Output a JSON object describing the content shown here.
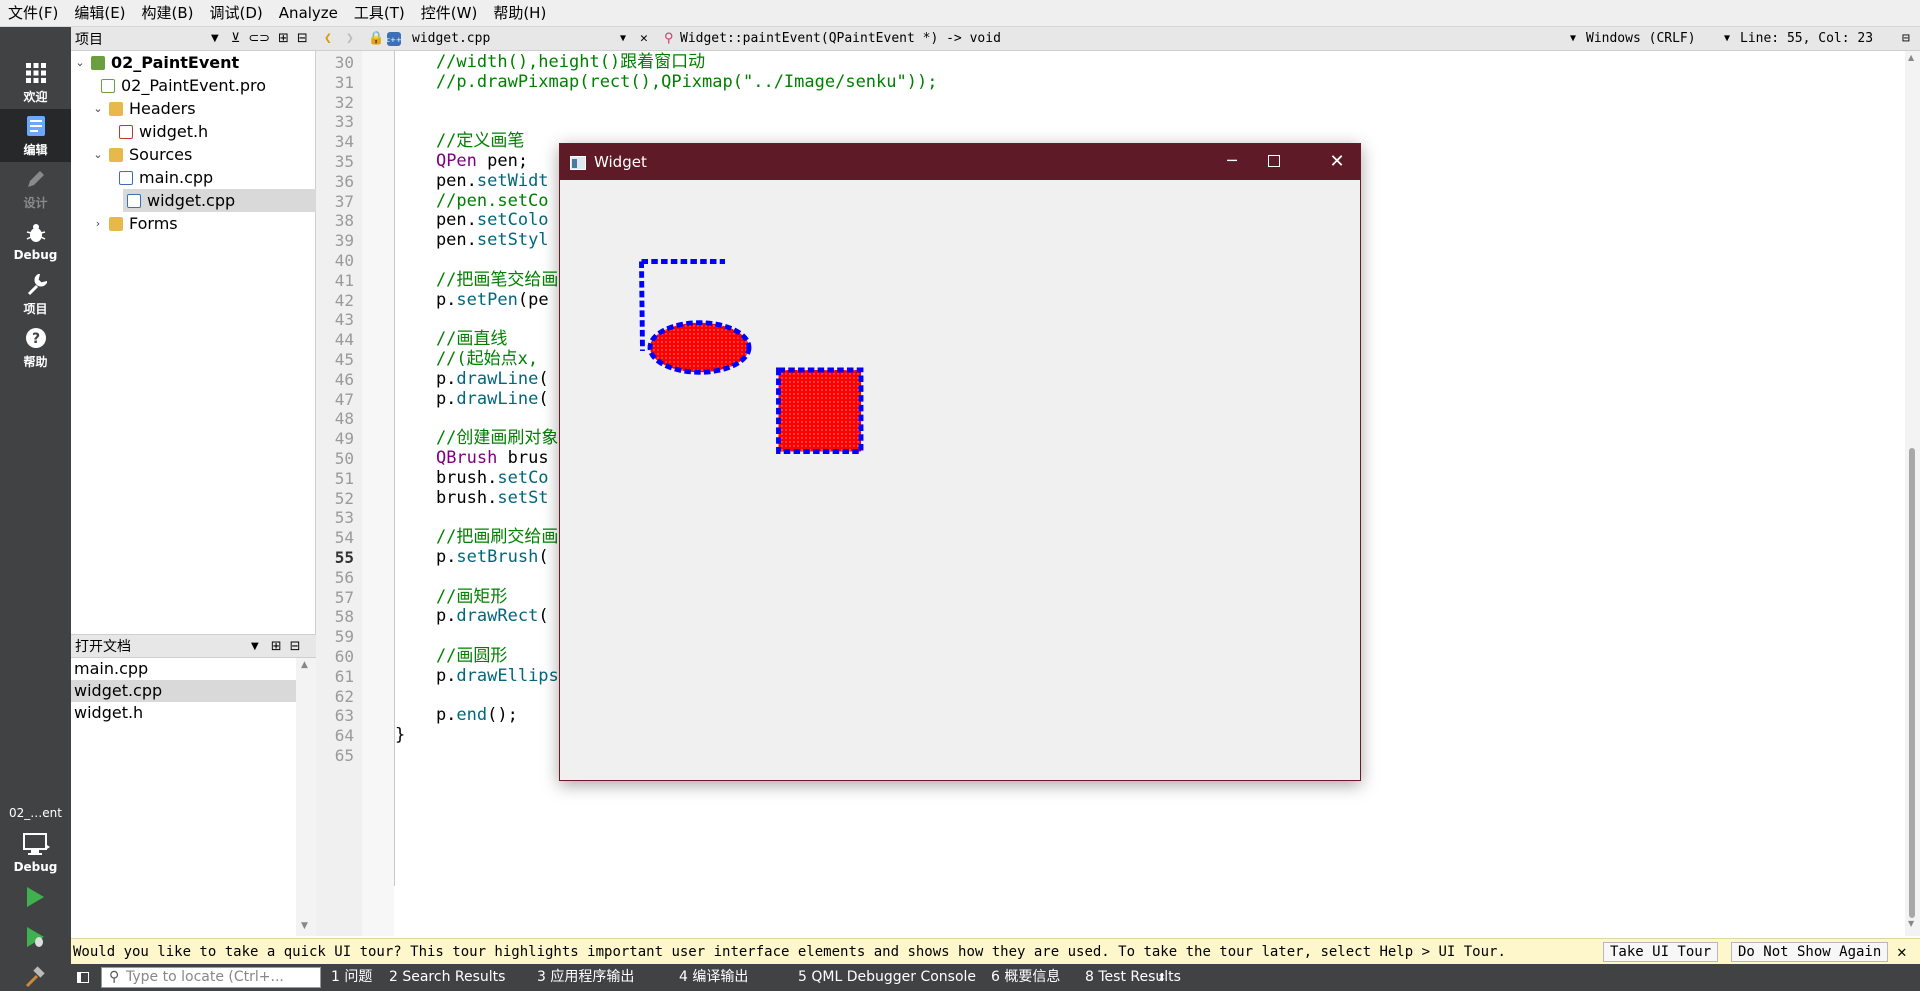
{
  "menu": [
    "文件(F)",
    "编辑(E)",
    "构建(B)",
    "调试(D)",
    "Analyze",
    "工具(T)",
    "控件(W)",
    "帮助(H)"
  ],
  "modes": [
    {
      "label": "欢迎",
      "icon": "grid-icon"
    },
    {
      "label": "编辑",
      "icon": "edit-icon"
    },
    {
      "label": "设计",
      "icon": "pencil-icon"
    },
    {
      "label": "Debug",
      "icon": "bug-icon"
    },
    {
      "label": "项目",
      "icon": "wrench-icon"
    },
    {
      "label": "帮助",
      "icon": "help-icon"
    }
  ],
  "kit": {
    "project": "02_…ent",
    "mode": "Debug"
  },
  "project_panel": {
    "title": "项目",
    "tree": [
      {
        "label": "02_PaintEvent",
        "level": 0,
        "expanded": true
      },
      {
        "label": "02_PaintEvent.pro",
        "level": 1
      },
      {
        "label": "Headers",
        "level": 1,
        "expanded": true
      },
      {
        "label": "widget.h",
        "level": 2
      },
      {
        "label": "Sources",
        "level": 1,
        "expanded": true
      },
      {
        "label": "main.cpp",
        "level": 2
      },
      {
        "label": "widget.cpp",
        "level": 2,
        "selected": true
      },
      {
        "label": "Forms",
        "level": 1,
        "expanded": false
      }
    ]
  },
  "open_docs": {
    "title": "打开文档",
    "items": [
      "main.cpp",
      "widget.cpp",
      "widget.h"
    ],
    "selected": "widget.cpp"
  },
  "editor_toolbar": {
    "file": "widget.cpp",
    "symbol": "Widget::paintEvent(QPaintEvent *) -> void",
    "line_ending": "Windows (CRLF)",
    "position": "Line: 55, Col: 23"
  },
  "editor": {
    "current_line": 55,
    "lines": [
      {
        "n": 30,
        "code": "    //width(),height()跟着窗口动"
      },
      {
        "n": 31,
        "code": "    //p.drawPixmap(rect(),QPixmap(\"../Image/senku\"));"
      },
      {
        "n": 32,
        "code": ""
      },
      {
        "n": 33,
        "code": ""
      },
      {
        "n": 34,
        "code": "    //定义画笔"
      },
      {
        "n": 35,
        "code": "    QPen pen;"
      },
      {
        "n": 36,
        "code": "    pen.setWidt"
      },
      {
        "n": 37,
        "code": "    //pen.setCo"
      },
      {
        "n": 38,
        "code": "    pen.setColo"
      },
      {
        "n": 39,
        "code": "    pen.setStyl"
      },
      {
        "n": 40,
        "code": ""
      },
      {
        "n": 41,
        "code": "    //把画笔交给画"
      },
      {
        "n": 42,
        "code": "    p.setPen(pe"
      },
      {
        "n": 43,
        "code": ""
      },
      {
        "n": 44,
        "code": "    //画直线"
      },
      {
        "n": 45,
        "code": "    //(起始点x,"
      },
      {
        "n": 46,
        "code": "    p.drawLine("
      },
      {
        "n": 47,
        "code": "    p.drawLine("
      },
      {
        "n": 48,
        "code": ""
      },
      {
        "n": 49,
        "code": "    //创建画刷对象"
      },
      {
        "n": 50,
        "code": "    QBrush brus"
      },
      {
        "n": 51,
        "code": "    brush.setCo"
      },
      {
        "n": 52,
        "code": "    brush.setSt"
      },
      {
        "n": 53,
        "code": ""
      },
      {
        "n": 54,
        "code": "    //把画刷交给画"
      },
      {
        "n": 55,
        "code": "    p.setBrush("
      },
      {
        "n": 56,
        "code": ""
      },
      {
        "n": 57,
        "code": "    //画矩形"
      },
      {
        "n": 58,
        "code": "    p.drawRect("
      },
      {
        "n": 59,
        "code": ""
      },
      {
        "n": 60,
        "code": "    //画圆形"
      },
      {
        "n": 61,
        "code": "    p.drawEllipse(QPoint(150,150),50,25);"
      },
      {
        "n": 62,
        "code": ""
      },
      {
        "n": 63,
        "code": "    p.end();"
      },
      {
        "n": 64,
        "code": "}"
      },
      {
        "n": 65,
        "code": ""
      }
    ]
  },
  "widget_window": {
    "title": "Widget",
    "pen_color": "#0000ff",
    "brush_color": "#ff0000"
  },
  "infobar": {
    "message": "Would you like to take a quick UI tour? This tour highlights important user interface elements and shows how they are used. To take the tour later, select Help > UI Tour.",
    "take_tour": "Take UI Tour",
    "dont_show": "Do Not Show Again"
  },
  "statusbar": {
    "locator_placeholder": "Type to locate (Ctrl+...",
    "panes": [
      "1 问题",
      "2 Search Results",
      "3 应用程序输出",
      "4 编译输出",
      "5 QML Debugger Console",
      "6 概要信息",
      "8 Test Results"
    ]
  }
}
